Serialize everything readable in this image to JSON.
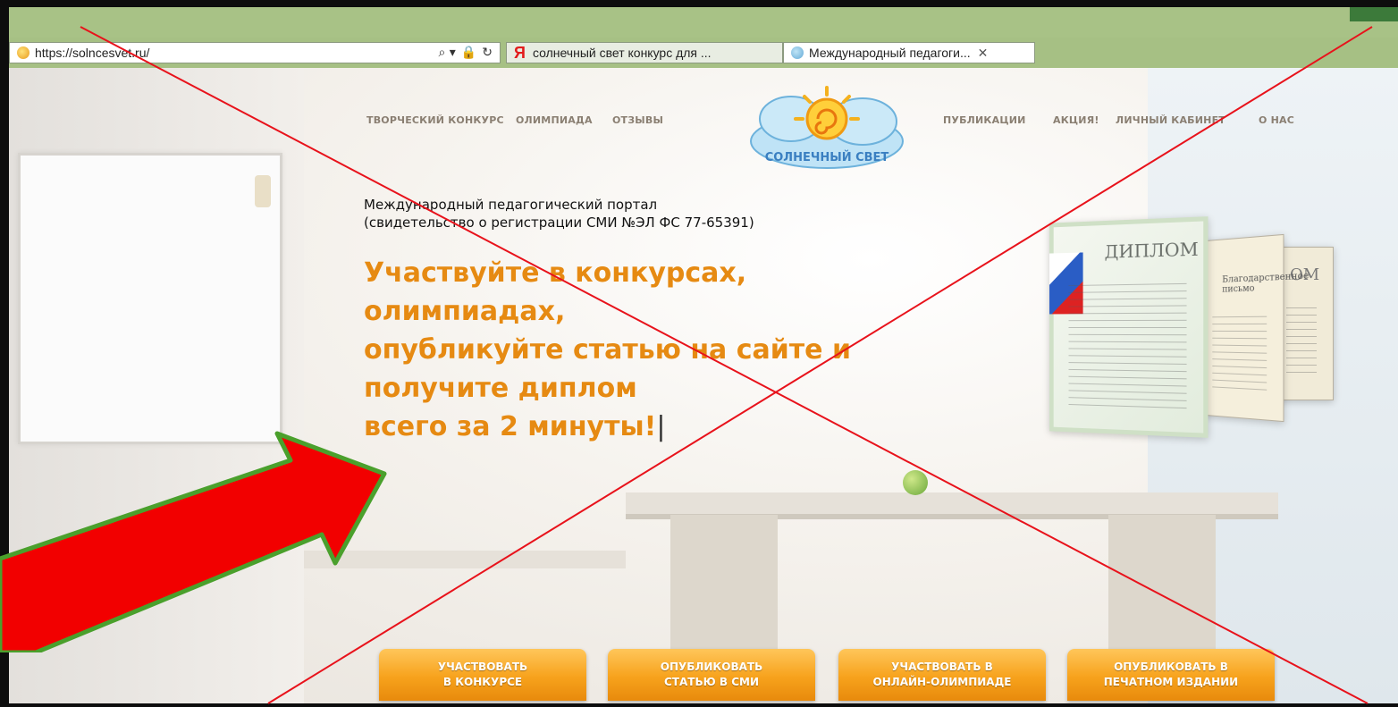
{
  "browser": {
    "url": "https://solncesvet.ru/",
    "tools": [
      "⌕ ▾",
      "🔒",
      "↻"
    ],
    "tabs": [
      {
        "label": "солнечный свет конкурс для ...",
        "icon": "yandex-logo-icon"
      },
      {
        "label": "Международный педагоги...",
        "icon": "site-favicon-icon",
        "close": "✕"
      }
    ]
  },
  "nav": {
    "left": [
      "ТВОРЧЕСКИЙ КОНКУРС",
      "ОЛИМПИАДА",
      "ОТЗЫВЫ"
    ],
    "right": [
      "ПУБЛИКАЦИИ",
      "АКЦИЯ!",
      "ЛИЧНЫЙ КАБИНЕТ",
      "О НАС"
    ]
  },
  "logo": {
    "text": "СОЛНЕЧНЫЙ СВЕТ"
  },
  "intro": {
    "line1": "Международный педагогический портал",
    "line2": "(свидетельство о регистрации СМИ №ЭЛ ФС 77-65391)"
  },
  "headline": [
    "Участвуйте в конкурсах,",
    "олимпиадах,",
    "опубликуйте статью на сайте и",
    "получите диплом",
    "всего за 2 минуты!"
  ],
  "headline_cursor": "|",
  "diplomas": {
    "front_title": "ДИПЛОМ",
    "mid_title": "Благодарственное письмо",
    "back_title": "ОМ"
  },
  "buttons": [
    {
      "line1": "УЧАСТВОВАТЬ",
      "line2": "В КОНКУРСЕ"
    },
    {
      "line1": "ОПУБЛИКОВАТЬ",
      "line2": "СТАТЬЮ В СМИ"
    },
    {
      "line1": "УЧАСТВОВАТЬ В",
      "line2": "ОНЛАЙН-ОЛИМПИАДЕ"
    },
    {
      "line1": "ОПУБЛИКОВАТЬ В",
      "line2": "ПЕЧАТНОМ ИЗДАНИИ"
    }
  ],
  "colors": {
    "accent_orange": "#e68a12",
    "button_orange": "#f7a21c",
    "browser_green": "#a6c084",
    "arrow_red": "#f20000",
    "arrow_outline": "#4aa02c",
    "cross_lines": "#e8121b"
  }
}
